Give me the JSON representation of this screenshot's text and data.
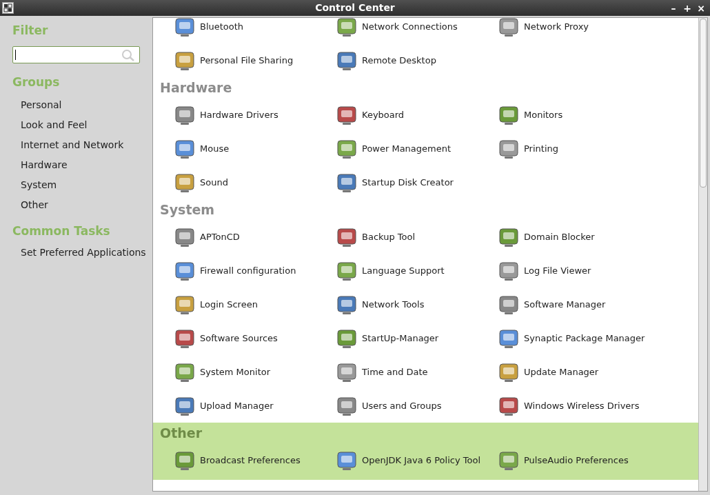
{
  "window": {
    "title": "Control Center",
    "controls": [
      "–",
      "+",
      "×"
    ]
  },
  "sidebar": {
    "filter": {
      "title": "Filter"
    },
    "groups": {
      "title": "Groups",
      "items": [
        "Personal",
        "Look and Feel",
        "Internet and Network",
        "Hardware",
        "System",
        "Other"
      ]
    },
    "common_tasks": {
      "title": "Common Tasks",
      "items": [
        "Set Preferred Applications"
      ]
    }
  },
  "sections": [
    {
      "highlighted": false,
      "items": [
        "Bluetooth",
        "Network Connections",
        "Network Proxy",
        "Personal File Sharing",
        "Remote Desktop"
      ]
    },
    {
      "title": "Hardware",
      "highlighted": false,
      "items": [
        "Hardware Drivers",
        "Keyboard",
        "Monitors",
        "Mouse",
        "Power Management",
        "Printing",
        "Sound",
        "Startup Disk Creator"
      ]
    },
    {
      "title": "System",
      "highlighted": false,
      "items": [
        "APTonCD",
        "Backup Tool",
        "Domain Blocker",
        "Firewall configuration",
        "Language Support",
        "Log File Viewer",
        "Login Screen",
        "Network Tools",
        "Software Manager",
        "Software Sources",
        "StartUp-Manager",
        "Synaptic Package Manager",
        "System Monitor",
        "Time and Date",
        "Update Manager",
        "Upload Manager",
        "Users and Groups",
        "Windows Wireless Drivers"
      ]
    },
    {
      "title": "Other",
      "highlighted": true,
      "items": [
        "Broadcast Preferences",
        "OpenJDK Java 6 Policy Tool",
        "PulseAudio Preferences"
      ]
    }
  ]
}
